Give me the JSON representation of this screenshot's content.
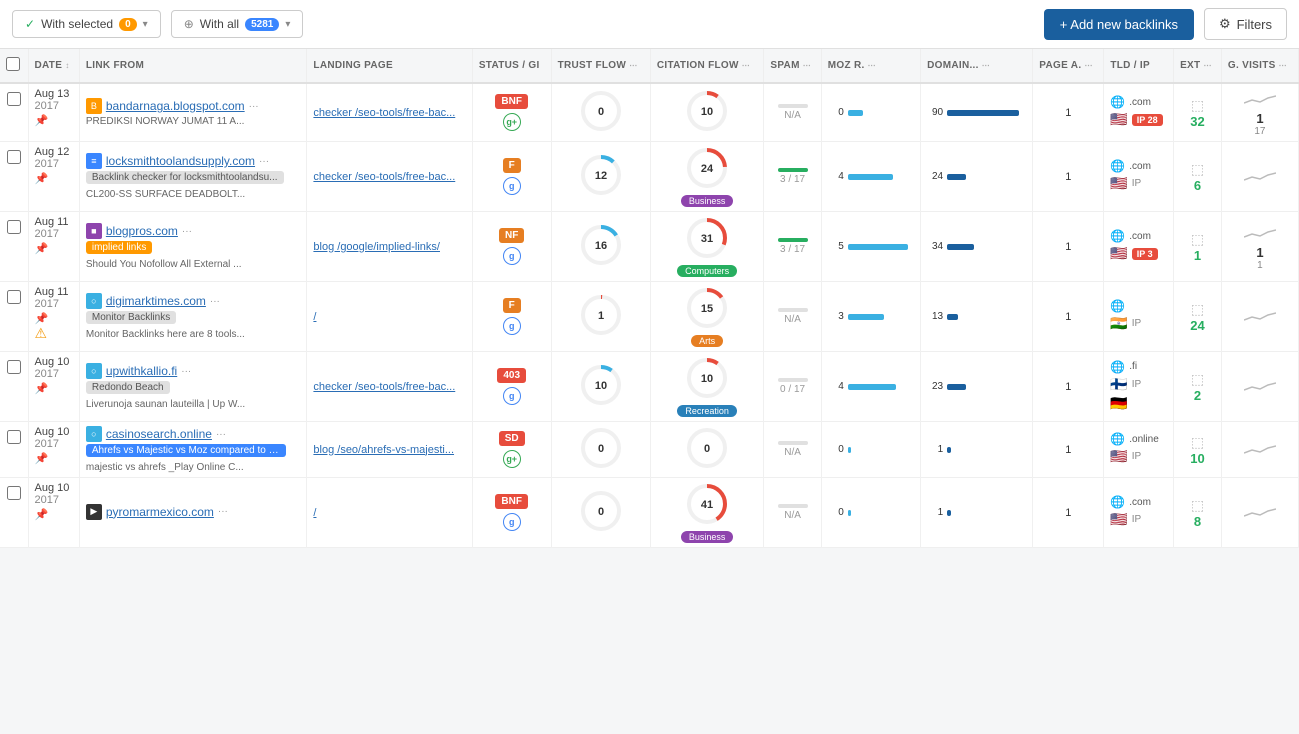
{
  "toolbar": {
    "with_selected_label": "With selected",
    "with_selected_count": "0",
    "with_all_label": "With all",
    "with_all_count": "5281",
    "add_backlinks_label": "+ Add new backlinks",
    "filters_label": "Filters"
  },
  "table": {
    "headers": [
      {
        "key": "cb",
        "label": ""
      },
      {
        "key": "date",
        "label": "DATE"
      },
      {
        "key": "link_from",
        "label": "LINK FROM"
      },
      {
        "key": "landing_page",
        "label": "LANDING PAGE"
      },
      {
        "key": "status_gi",
        "label": "STATUS / GI"
      },
      {
        "key": "trust_flow",
        "label": "TRUST FLOW"
      },
      {
        "key": "citation_flow",
        "label": "CITATION FLOW"
      },
      {
        "key": "spam",
        "label": "SPAM"
      },
      {
        "key": "moz_r",
        "label": "MOZ R."
      },
      {
        "key": "domain",
        "label": "DOMAIN..."
      },
      {
        "key": "page_a",
        "label": "PAGE A."
      },
      {
        "key": "tld_ip",
        "label": "TLD / IP"
      },
      {
        "key": "ext",
        "label": "EXT"
      },
      {
        "key": "g_visits",
        "label": "G. VISITS"
      }
    ],
    "rows": [
      {
        "date": "Aug 13",
        "year": "2017",
        "domain": "bandarnaga.blogspot.com",
        "domain_icon": "B",
        "domain_icon_color": "#f90",
        "tag": "",
        "title": "PREDIKSI NORWAY JUMAT 11 A...",
        "landing_page": "checker /seo-tools/free-bac...",
        "status": "BNF",
        "status_class": "s-bnf",
        "google_index": "g+",
        "trust_flow": 0,
        "citation_flow": 10,
        "tf_red_arc": 0,
        "cf_red_arc": 10,
        "category": "",
        "spam": "N/A",
        "spam_val": 0,
        "moz_r": 0,
        "moz_bar": 5,
        "domain_val": 90,
        "domain_bar": 90,
        "page_a": 1,
        "tld": ".com",
        "flag1": "🇺🇸",
        "flag2": "",
        "ip_badge": "28",
        "ip_class": "ip-red",
        "ext": "",
        "ext_num": 32,
        "gv_num": 1,
        "gv_sub": "17",
        "warn": false
      },
      {
        "date": "Aug 12",
        "year": "2017",
        "domain": "locksmithtoolandsupply.com",
        "domain_icon": "≡",
        "domain_icon_color": "#3a86ff",
        "tag": "Backlink checker for locksmithtoolandsu...",
        "tag_class": "tag-gray",
        "title": "CL200-SS SURFACE DEADBOLT...",
        "landing_page": "checker /seo-tools/free-bac...",
        "status": "F",
        "status_class": "s-f",
        "google_index": "g",
        "trust_flow": 12,
        "citation_flow": 24,
        "category": "Business",
        "cat_class": "cat-business",
        "spam": "3 / 17",
        "spam_val": 18,
        "moz_r": 4,
        "moz_bar": 15,
        "domain_val": 24,
        "domain_bar": 24,
        "page_a": 1,
        "tld": ".com",
        "flag1": "🇺🇸",
        "flag2": "",
        "ip_badge": "",
        "ip_class": "",
        "ext": "",
        "ext_num": 6,
        "gv_num": "",
        "gv_sub": "",
        "warn": false
      },
      {
        "date": "Aug 11",
        "year": "2017",
        "domain": "blogpros.com",
        "domain_icon": "■",
        "domain_icon_color": "#8e44ad",
        "tag": "implied links",
        "tag_class": "tag-orange",
        "title": "Should You Nofollow All External ...",
        "landing_page": "blog /google/implied-links/",
        "status": "NF",
        "status_class": "s-nf",
        "google_index": "g",
        "trust_flow": 16,
        "citation_flow": 31,
        "category": "Computers",
        "cat_class": "cat-computers",
        "spam": "3 / 17",
        "spam_val": 18,
        "moz_r": 5,
        "moz_bar": 20,
        "domain_val": 34,
        "domain_bar": 34,
        "page_a": 1,
        "tld": ".com",
        "flag1": "🇺🇸",
        "flag2": "",
        "ip_badge": "3",
        "ip_class": "ip-red",
        "ext": "",
        "ext_num": 1,
        "gv_num": 1,
        "gv_sub": "1",
        "warn": false
      },
      {
        "date": "Aug 11",
        "year": "2017",
        "domain": "digimarktimes.com",
        "domain_icon": "○",
        "domain_icon_color": "#3ab0e2",
        "tag": "Monitor Backlinks",
        "tag_class": "tag-gray",
        "title": "Monitor Backlinks here are 8 tools...",
        "landing_page": "/",
        "status": "F",
        "status_class": "s-f",
        "google_index": "g",
        "trust_flow": 1,
        "citation_flow": 15,
        "category": "Arts",
        "cat_class": "cat-arts",
        "spam": "N/A",
        "spam_val": 0,
        "moz_r": 3,
        "moz_bar": 12,
        "domain_val": 13,
        "domain_bar": 13,
        "page_a": 1,
        "tld": "",
        "flag1": "🇮🇳",
        "flag2": "",
        "ip_badge": "",
        "ip_class": "",
        "ext": "",
        "ext_num": 24,
        "gv_num": "",
        "gv_sub": "",
        "warn": true
      },
      {
        "date": "Aug 10",
        "year": "2017",
        "domain": "upwithkallio.fi",
        "domain_icon": "○",
        "domain_icon_color": "#3ab0e2",
        "tag": "Redondo Beach",
        "tag_class": "tag-gray",
        "title": "Liverunoja saunan lauteilla | Up W...",
        "landing_page": "checker /seo-tools/free-bac...",
        "status": "403",
        "status_class": "s-403",
        "google_index": "g",
        "trust_flow": 10,
        "citation_flow": 10,
        "category": "Recreation",
        "cat_class": "cat-recreation",
        "spam": "0 / 17",
        "spam_val": 0,
        "moz_r": 4,
        "moz_bar": 16,
        "domain_val": 23,
        "domain_bar": 23,
        "page_a": 1,
        "tld": ".fi",
        "flag1": "🇫🇮",
        "flag2": "🇩🇪",
        "ip_badge": "",
        "ip_class": "",
        "ext": "",
        "ext_num": 2,
        "gv_num": "",
        "gv_sub": "",
        "warn": false
      },
      {
        "date": "Aug 10",
        "year": "2017",
        "domain": "casinosearch.online",
        "domain_icon": "○",
        "domain_icon_color": "#3ab0e2",
        "tag": "Ahrefs vs Majestic vs Moz compared to M...",
        "tag_class": "tag-blue",
        "title": "majestic vs ahrefs _Play Online C...",
        "landing_page": "blog /seo/ahrefs-vs-majesti...",
        "status": "SD",
        "status_class": "s-sd",
        "google_index": "g+",
        "trust_flow": 0,
        "citation_flow": 0,
        "category": "",
        "spam": "N/A",
        "spam_val": 0,
        "moz_r": 0,
        "moz_bar": 1,
        "domain_val": 1,
        "domain_bar": 1,
        "page_a": 1,
        "tld": ".online",
        "flag1": "🇺🇸",
        "flag2": "",
        "ip_badge": "",
        "ip_class": "",
        "ext": "",
        "ext_num": 10,
        "gv_num": "",
        "gv_sub": "",
        "warn": false
      },
      {
        "date": "Aug 10",
        "year": "2017",
        "domain": "pyromarmexico.com",
        "domain_icon": "▶",
        "domain_icon_color": "#333",
        "tag": "",
        "title": "",
        "landing_page": "/",
        "status": "BNF",
        "status_class": "s-bnf",
        "google_index": "g",
        "trust_flow": 0,
        "citation_flow": 41,
        "category": "Business",
        "cat_class": "cat-business",
        "spam": "N/A",
        "spam_val": 0,
        "moz_r": 0,
        "moz_bar": 1,
        "domain_val": 1,
        "domain_bar": 1,
        "page_a": 1,
        "tld": ".com",
        "flag1": "🇺🇸",
        "flag2": "",
        "ip_badge": "",
        "ip_class": "",
        "ext": "",
        "ext_num": 8,
        "gv_num": "",
        "gv_sub": "",
        "warn": false
      }
    ]
  }
}
